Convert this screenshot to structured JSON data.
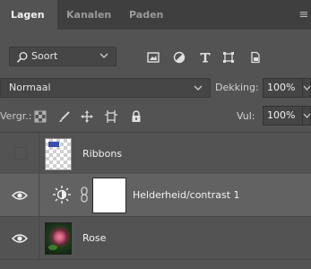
{
  "tabs": [
    {
      "label": "Lagen",
      "active": true
    },
    {
      "label": "Kanalen",
      "active": false
    },
    {
      "label": "Paden",
      "active": false
    }
  ],
  "panel_menu_icon": "hamburger-menu-icon",
  "filter": {
    "kind_label": "Soort",
    "icons": [
      "pixel-layer-filter-icon",
      "adjustment-layer-filter-icon",
      "type-layer-filter-icon",
      "shape-layer-filter-icon",
      "smart-object-filter-icon"
    ]
  },
  "blend": {
    "mode": "Normaal",
    "opacity_label": "Dekking:",
    "opacity_value": "100%"
  },
  "lock": {
    "label": "Vergr.:",
    "icons": [
      "lock-transparent-pixels-icon",
      "lock-image-pixels-icon",
      "lock-position-icon",
      "lock-artboard-icon",
      "lock-all-icon"
    ],
    "fill_label": "Vul:",
    "fill_value": "100%"
  },
  "layers": [
    {
      "name": "Ribbons",
      "visible": false,
      "type": "pixel"
    },
    {
      "name": "Helderheid/contrast 1",
      "visible": true,
      "type": "adjustment",
      "selected": true
    },
    {
      "name": "Rose",
      "visible": true,
      "type": "pixel"
    }
  ],
  "colors": {
    "panel_bg": "#535353",
    "tab_bar_bg": "#3f3f3f",
    "selected_row_bg": "#626262",
    "text": "#f2f2f2"
  }
}
